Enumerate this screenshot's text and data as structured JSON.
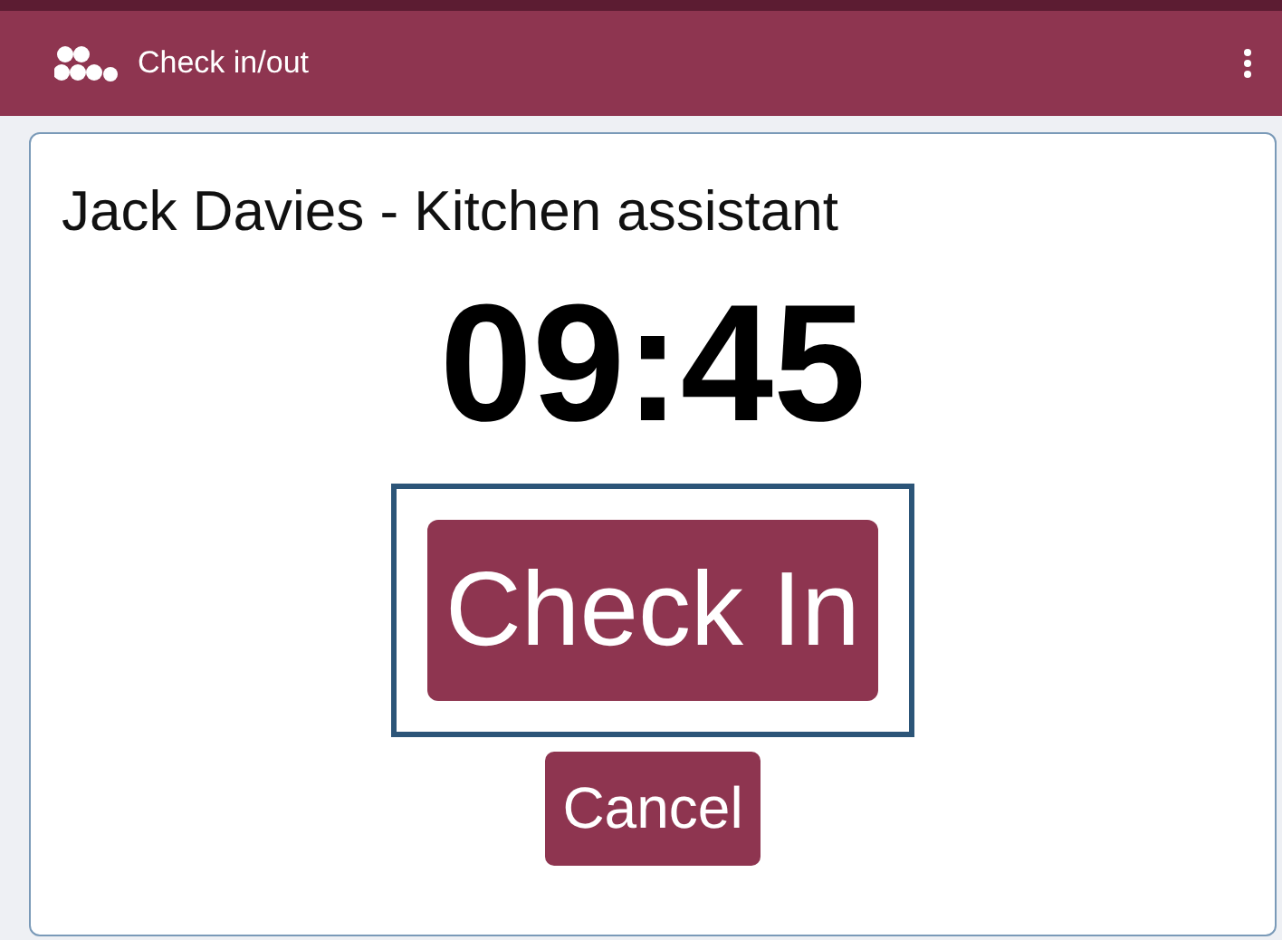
{
  "app_bar": {
    "title": "Check in/out"
  },
  "card": {
    "employee": "Jack Davies - Kitchen assistant",
    "time": "09:45",
    "check_in_button": {
      "label": "Check In",
      "focused": true
    },
    "cancel_button": {
      "label": "Cancel"
    }
  }
}
